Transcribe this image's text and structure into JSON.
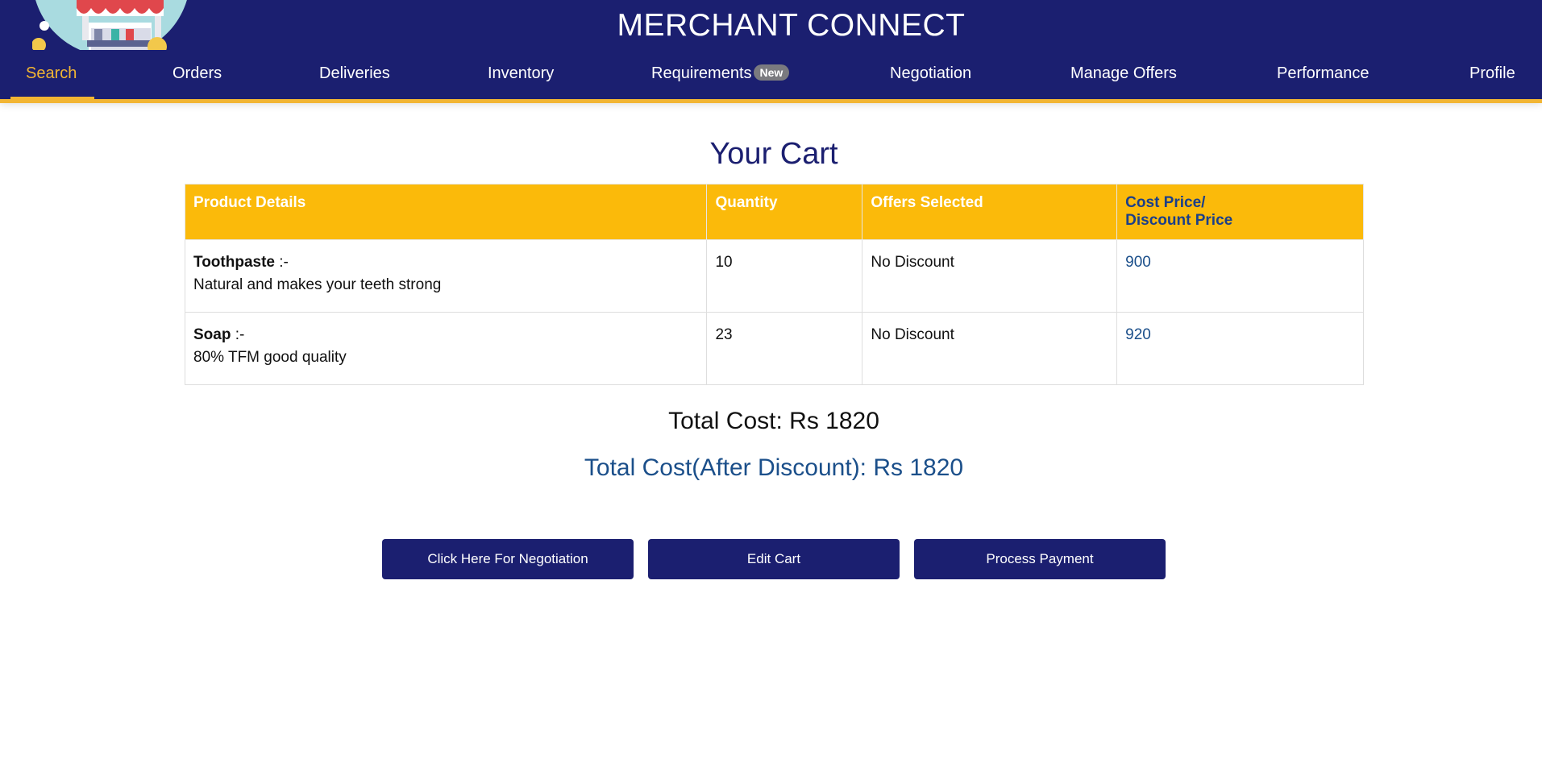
{
  "app": {
    "title": "MERCHANT CONNECT"
  },
  "nav": {
    "items": [
      {
        "label": "Search",
        "active": true
      },
      {
        "label": "Orders"
      },
      {
        "label": "Deliveries"
      },
      {
        "label": "Inventory"
      },
      {
        "label": "Requirements",
        "badge": "New"
      },
      {
        "label": "Negotiation"
      },
      {
        "label": "Manage Offers"
      },
      {
        "label": "Performance"
      },
      {
        "label": "Profile"
      }
    ]
  },
  "cart": {
    "title": "Your Cart",
    "headers": {
      "product": "Product Details",
      "quantity": "Quantity",
      "offers": "Offers Selected",
      "price_line1": "Cost Price/",
      "price_line2": "Discount Price"
    },
    "rows": [
      {
        "name": "Toothpaste",
        "sep": " :-",
        "description": "Natural and makes your teeth strong",
        "quantity": "10",
        "offer": "No Discount",
        "price": "900"
      },
      {
        "name": "Soap",
        "sep": " :-",
        "description": "80% TFM good quality",
        "quantity": "23",
        "offer": "No Discount",
        "price": "920"
      }
    ],
    "total_cost": "Total Cost: Rs 1820",
    "total_after_discount": "Total Cost(After Discount): Rs 1820"
  },
  "buttons": {
    "negotiation": "Click Here For Negotiation",
    "edit_cart": "Edit Cart",
    "process_payment": "Process Payment"
  },
  "colors": {
    "header_bg": "#1b1f70",
    "accent": "#f2b533",
    "table_header": "#fbba0a",
    "link_blue": "#1b4f8a"
  }
}
